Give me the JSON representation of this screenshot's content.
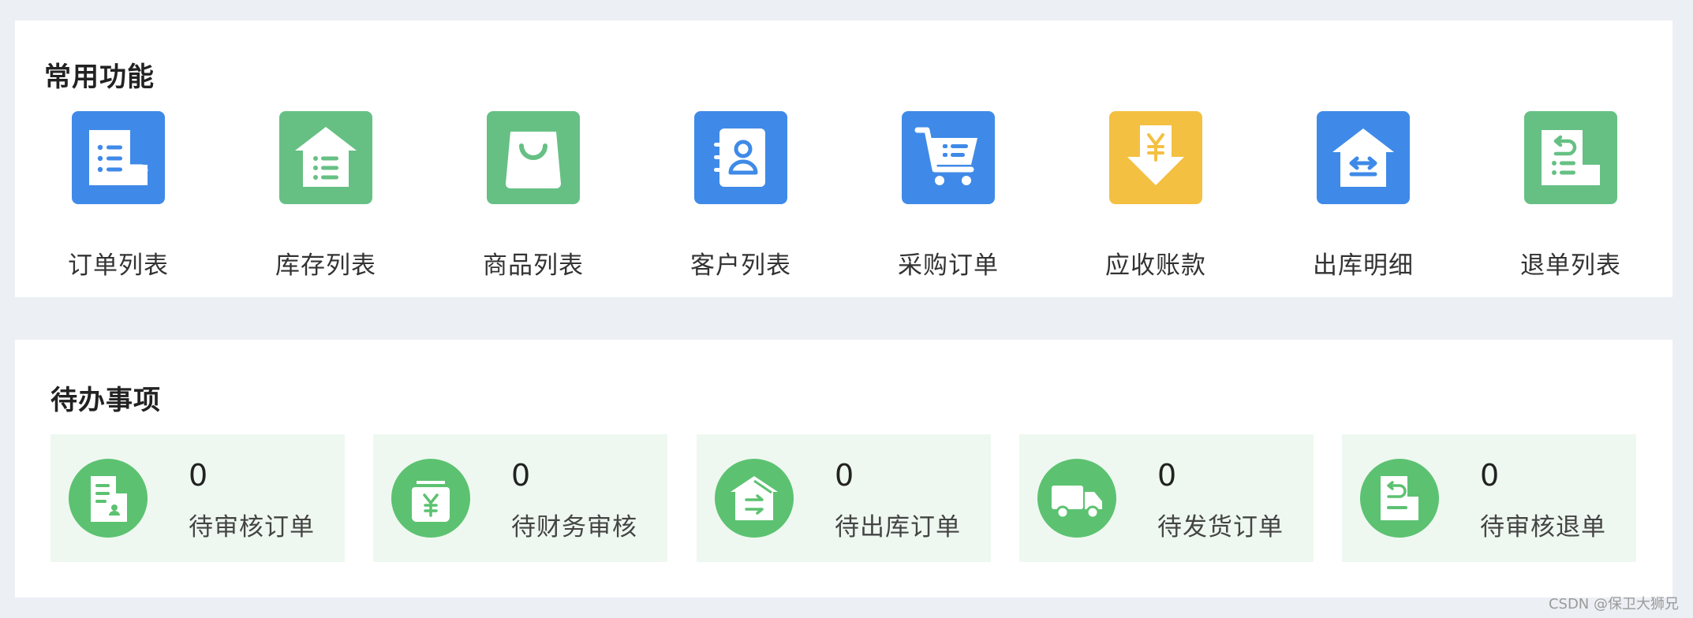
{
  "common_functions": {
    "title": "常用功能",
    "items": [
      {
        "label": "订单列表",
        "icon": "order-list-icon",
        "color": "#3f8ae8"
      },
      {
        "label": "库存列表",
        "icon": "inventory-list-icon",
        "color": "#66c084"
      },
      {
        "label": "商品列表",
        "icon": "shopping-bag-icon",
        "color": "#66c084"
      },
      {
        "label": "客户列表",
        "icon": "contact-book-icon",
        "color": "#3f8ae8"
      },
      {
        "label": "采购订单",
        "icon": "shopping-cart-icon",
        "color": "#3f8ae8"
      },
      {
        "label": "应收账款",
        "icon": "yuan-receivable-icon",
        "color": "#f4c042"
      },
      {
        "label": "出库明细",
        "icon": "warehouse-transfer-icon",
        "color": "#3f8ae8"
      },
      {
        "label": "退单列表",
        "icon": "return-order-icon",
        "color": "#66c084"
      }
    ]
  },
  "todo": {
    "title": "待办事项",
    "items": [
      {
        "count": "0",
        "label": "待审核订单",
        "icon": "pending-review-order-icon"
      },
      {
        "count": "0",
        "label": "待财务审核",
        "icon": "money-bag-yuan-icon"
      },
      {
        "count": "0",
        "label": "待出库订单",
        "icon": "warehouse-outbound-icon"
      },
      {
        "count": "0",
        "label": "待发货订单",
        "icon": "delivery-truck-icon"
      },
      {
        "count": "0",
        "label": "待审核退单",
        "icon": "return-document-icon"
      }
    ],
    "accent_color": "#5cc271",
    "item_background": "#eef8f0"
  },
  "watermark": "CSDN @保卫大狮兄"
}
